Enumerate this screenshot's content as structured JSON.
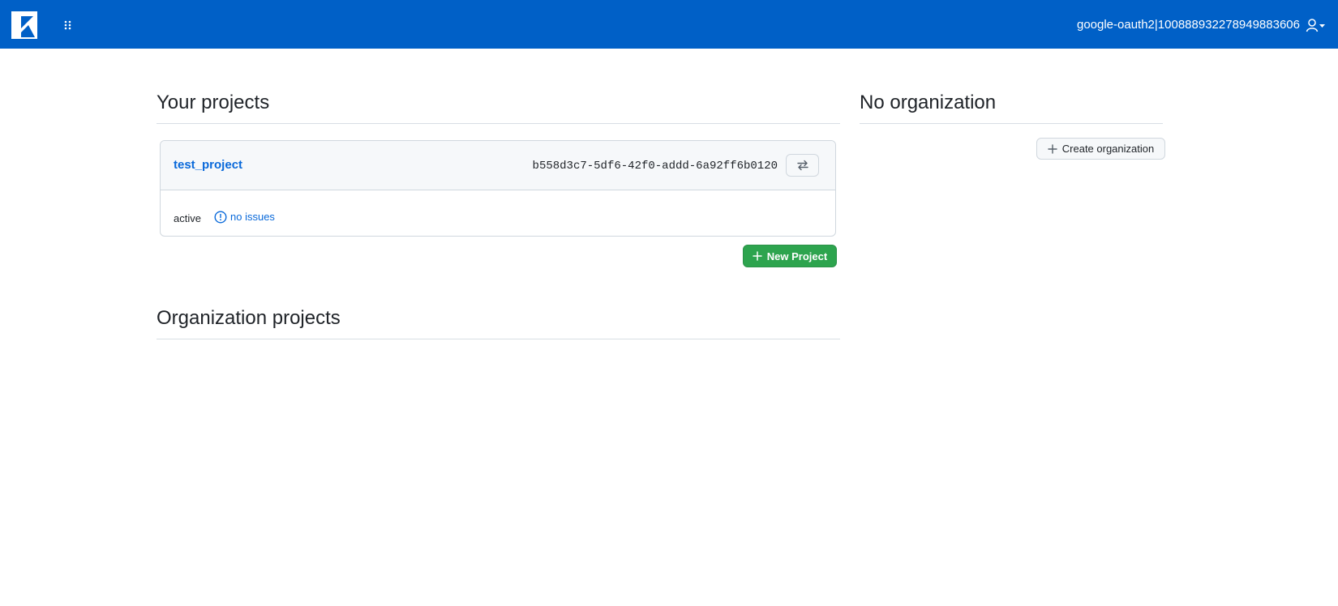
{
  "header": {
    "logo_icon": "k-logo-icon",
    "apps_icon": "grip-dots-icon",
    "username": "google-oauth2|100888932278949883606",
    "user_icon": "person-icon",
    "caret_icon": "caret-down-icon"
  },
  "your_projects": {
    "title": "Your projects",
    "projects": [
      {
        "name": "test_project",
        "id": "b558d3c7-5df6-42f0-addd-6a92ff6b0120",
        "switch_icon": "arrows-switch-icon",
        "status": "active",
        "issues_icon": "issue-circle-icon",
        "issues_label": "no issues"
      }
    ],
    "new_project_label": "New Project"
  },
  "organization_projects": {
    "title": "Organization projects"
  },
  "organization": {
    "title": "No organization",
    "create_label": "Create organization"
  },
  "colors": {
    "header_bg": "#0060c7",
    "primary_button": "#2da44e",
    "link": "#0969da"
  }
}
